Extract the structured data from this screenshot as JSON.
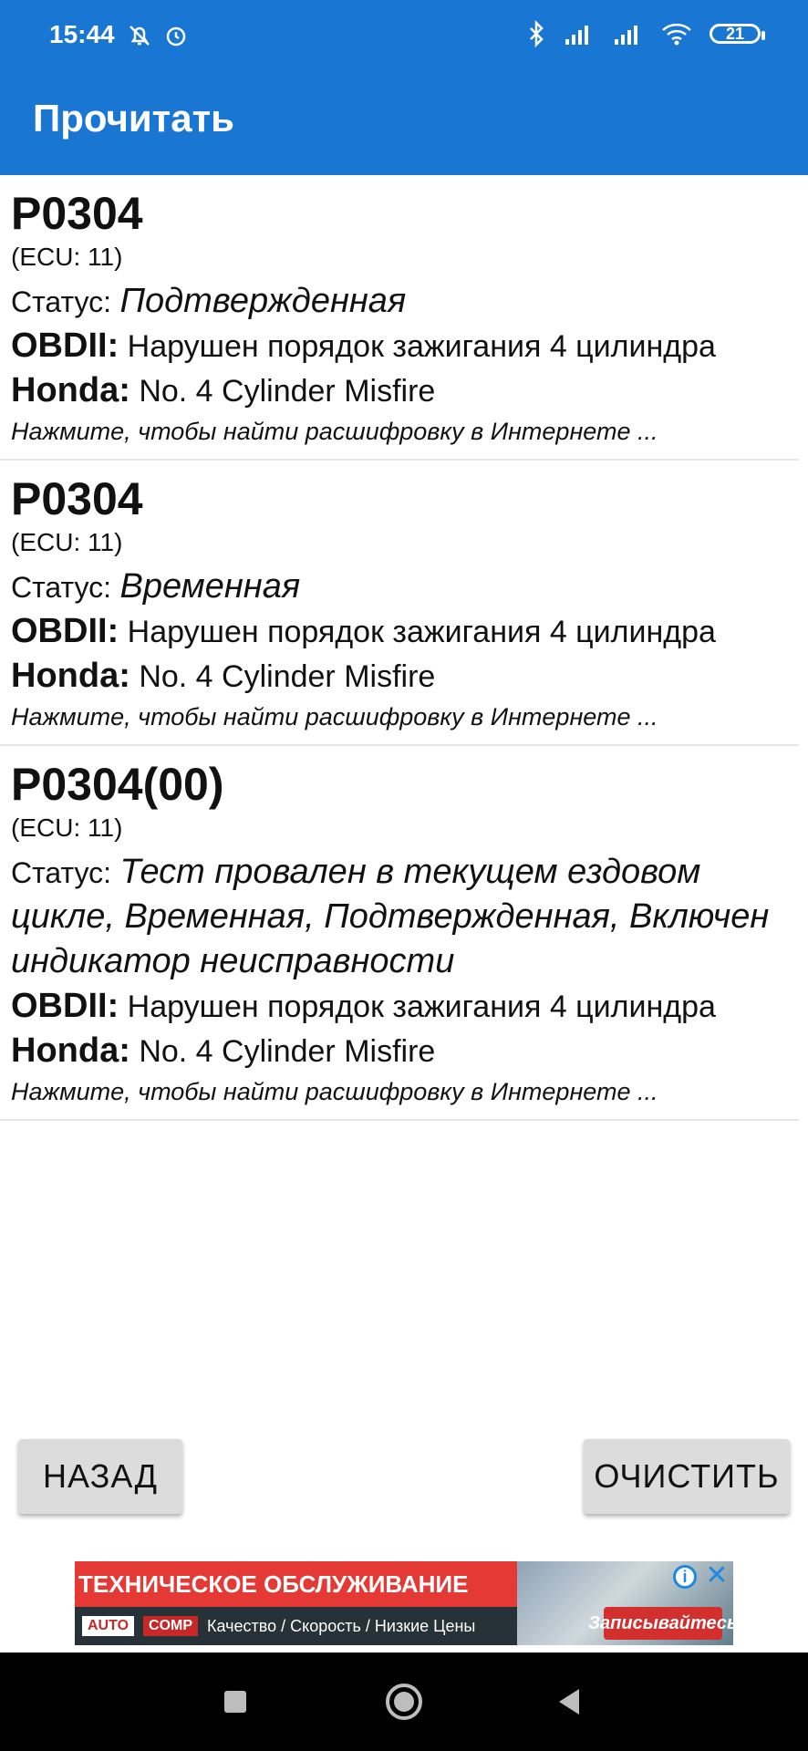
{
  "status_bar": {
    "time": "15:44",
    "battery": "21",
    "left_icons": [
      "bell-off-icon",
      "alarm-icon"
    ],
    "right_icons": [
      "bluetooth-icon",
      "signal-icon",
      "signal-icon",
      "wifi-icon"
    ]
  },
  "app_bar": {
    "title": "Прочитать"
  },
  "entries": [
    {
      "code": "P0304",
      "ecu": "(ECU: 11)",
      "status_label": "Статус:",
      "status_value": "Подтвержденная",
      "obd_label": "OBDII:",
      "obd_value": "Нарушен порядок зажигания 4 цилиндра",
      "make_label": "Honda:",
      "make_value": "No. 4 Cylinder Misfire",
      "hint": "Нажмите, чтобы найти расшифровку в Интернете ..."
    },
    {
      "code": "P0304",
      "ecu": "(ECU: 11)",
      "status_label": "Статус:",
      "status_value": "Временная",
      "obd_label": "OBDII:",
      "obd_value": "Нарушен порядок зажигания 4 цилиндра",
      "make_label": "Honda:",
      "make_value": "No. 4 Cylinder Misfire",
      "hint": "Нажмите, чтобы найти расшифровку в Интернете ..."
    },
    {
      "code": "P0304(00)",
      "ecu": "(ECU: 11)",
      "status_label": "Статус:",
      "status_value": "Тест провален в текущем ездовом цикле, Временная, Подтвержденная, Включен индикатор неисправности",
      "obd_label": "OBDII:",
      "obd_value": "Нарушен порядок зажигания 4 цилиндра",
      "make_label": "Honda:",
      "make_value": "No. 4 Cylinder Misfire",
      "hint": "Нажмите, чтобы найти расшифровку в Интернете ..."
    }
  ],
  "buttons": {
    "back": "НАЗАД",
    "clear": "ОЧИСТИТЬ"
  },
  "ad": {
    "headline": "ТЕХНИЧЕСКОЕ ОБСЛУЖИВАНИЕ",
    "logo1": "AUTO",
    "logo2": "COMP",
    "tagline": "Качество / Скорость / Низкие Цены",
    "cta": "Записывайтесь"
  },
  "colors": {
    "primary": "#1976d2",
    "button": "#dcdcdc",
    "divider": "#e6e6e6"
  }
}
